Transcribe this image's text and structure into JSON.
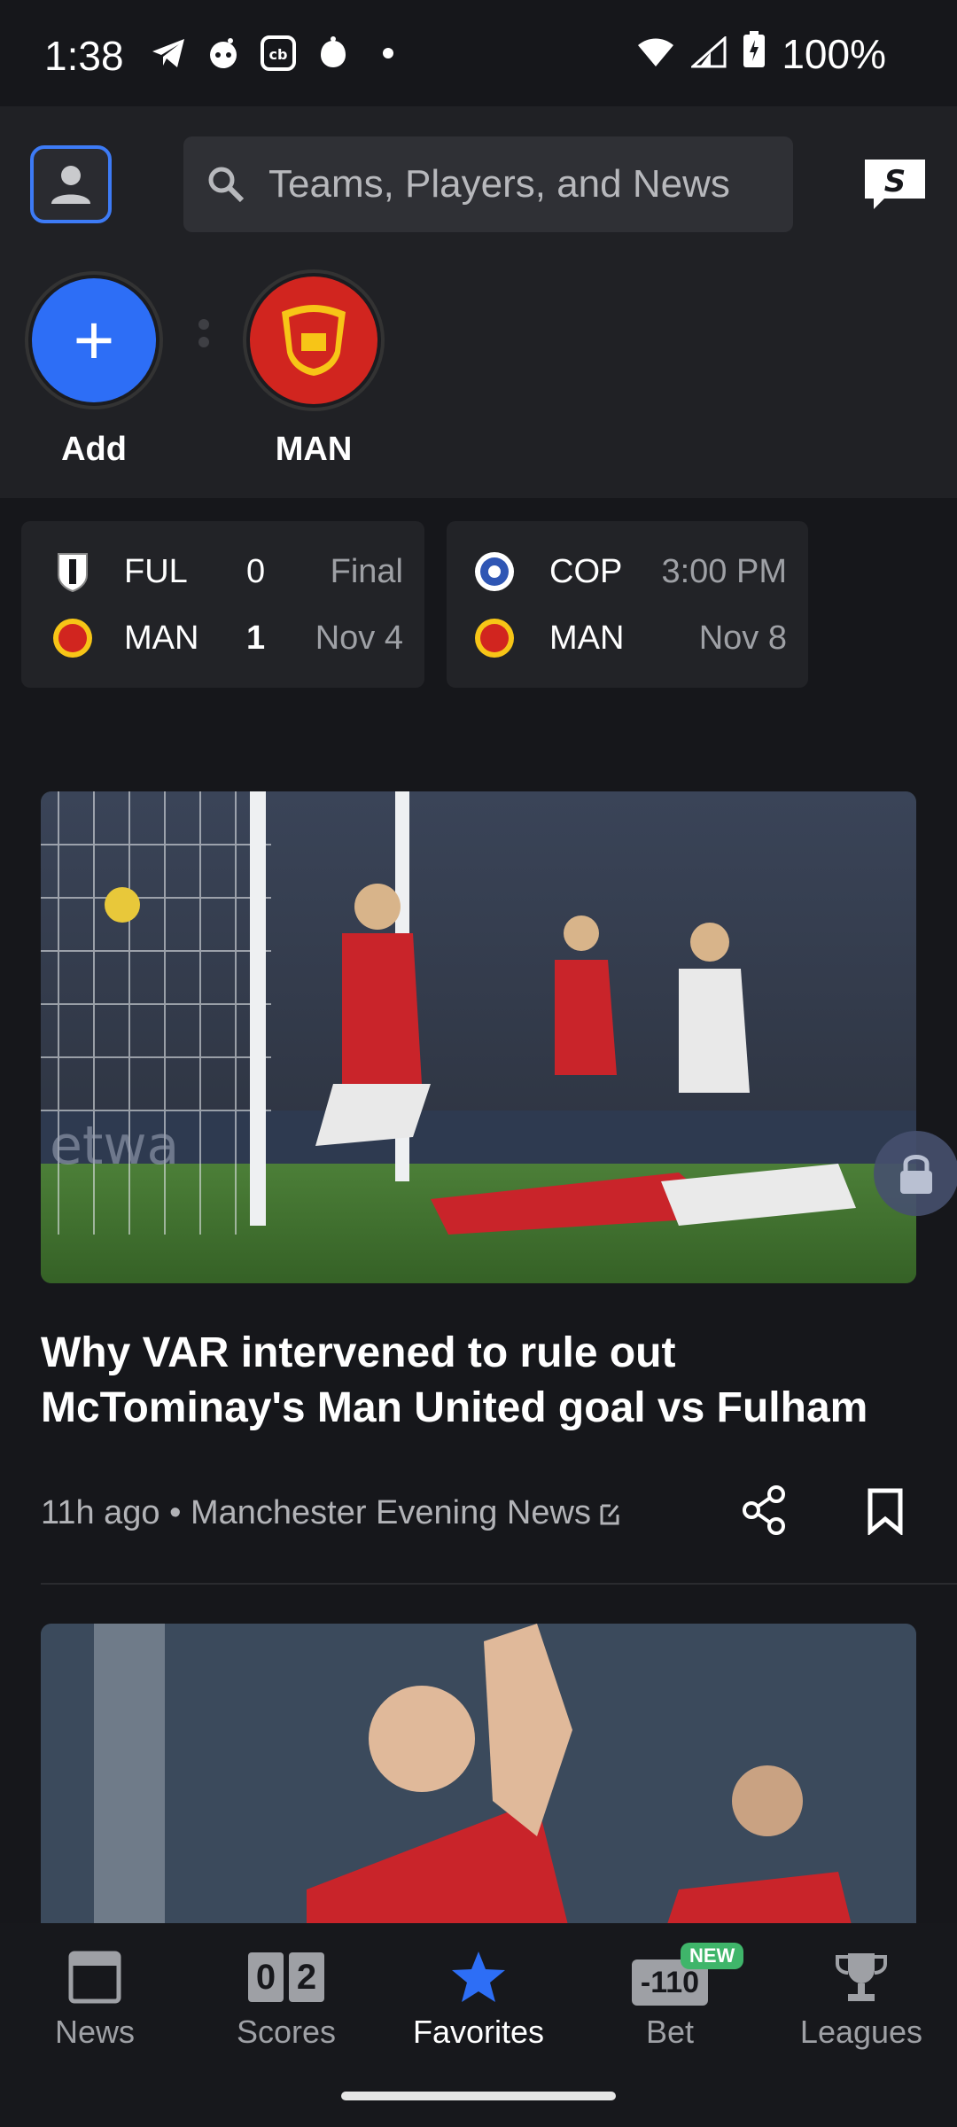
{
  "status_bar": {
    "time": "1:38",
    "battery": "100%",
    "icons": [
      "telegram-icon",
      "reddit-icon",
      "coinbase-icon",
      "bug-icon",
      "dot-icon",
      "wifi-icon",
      "signal-icon",
      "battery-icon"
    ]
  },
  "header": {
    "search_placeholder": "Teams, Players, and News"
  },
  "favorites": {
    "add_label": "Add",
    "team_label": "MAN"
  },
  "score_cards": [
    {
      "rows": [
        {
          "team": "FUL",
          "score": "0",
          "status": "Final"
        },
        {
          "team": "MAN",
          "score": "1",
          "status": "Nov 4"
        }
      ]
    },
    {
      "rows": [
        {
          "team": "COP",
          "status": "3:00 PM"
        },
        {
          "team": "MAN",
          "status": "Nov 8"
        }
      ]
    }
  ],
  "article": {
    "headline": "Why VAR intervened to rule out McTominay's Man United goal vs Fulham",
    "meta": "11h ago • Manchester Evening News"
  },
  "nav": {
    "items": [
      {
        "label": "News"
      },
      {
        "label": "Scores",
        "digits": [
          "0",
          "2"
        ]
      },
      {
        "label": "Favorites"
      },
      {
        "label": "Bet",
        "badge": "NEW",
        "icon_text": "-110"
      },
      {
        "label": "Leagues"
      }
    ],
    "active": "Favorites"
  },
  "colors": {
    "accent": "#2d6ef6",
    "background": "#16171b",
    "header": "#202125",
    "man_united_red": "#d1251f"
  }
}
